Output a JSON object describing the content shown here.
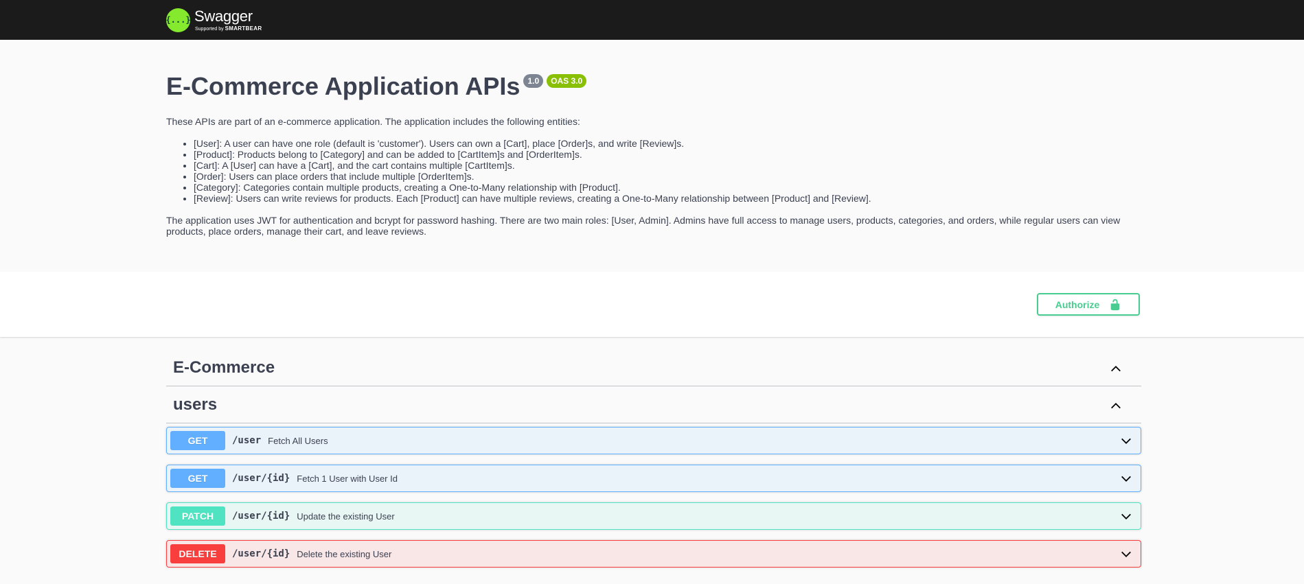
{
  "topbar": {
    "logo_glyph": "{...}",
    "logo_name": "Swagger",
    "logo_sub_prefix": "Supported by",
    "logo_sub_brand": "SMARTBEAR",
    "logo_color": "#85ea2d"
  },
  "info": {
    "title": "E-Commerce Application APIs",
    "version": "1.0",
    "oas": "OAS 3.0",
    "intro": "These APIs are part of an e-commerce application. The application includes the following entities:",
    "entities": [
      "[User]: A user can have one role (default is 'customer'). Users can own a [Cart], place [Order]s, and write [Review]s.",
      "[Product]: Products belong to [Category] and can be added to [CartItem]s and [OrderItem]s.",
      "[Cart]: A [User] can have a [Cart], and the cart contains multiple [CartItem]s.",
      "[Order]: Users can place orders that include multiple [OrderItem]s.",
      "[Category]: Categories contain multiple products, creating a One-to-Many relationship with [Product].",
      "[Review]: Users can write reviews for products. Each [Product] can have multiple reviews, creating a One-to-Many relationship between [Product] and [Review]."
    ],
    "footer": "The application uses JWT for authentication and bcrypt for password hashing. There are two main roles: [User, Admin]. Admins have full access to manage users, products, categories, and orders, while regular users can view products, place orders, manage their cart, and leave reviews."
  },
  "scheme": {
    "authorize_label": "Authorize",
    "authorize_color": "#49cc90"
  },
  "tags": [
    {
      "name": "E-Commerce",
      "expanded": true
    },
    {
      "name": "users",
      "expanded": true
    }
  ],
  "operations": [
    {
      "method": "GET",
      "path": "/user",
      "summary": "Fetch All Users",
      "color": "#61affe"
    },
    {
      "method": "GET",
      "path": "/user/{id}",
      "summary": "Fetch 1 User with User Id",
      "color": "#61affe"
    },
    {
      "method": "PATCH",
      "path": "/user/{id}",
      "summary": "Update the existing User",
      "color": "#50e3c2"
    },
    {
      "method": "DELETE",
      "path": "/user/{id}",
      "summary": "Delete the existing User",
      "color": "#f93e3e"
    }
  ]
}
